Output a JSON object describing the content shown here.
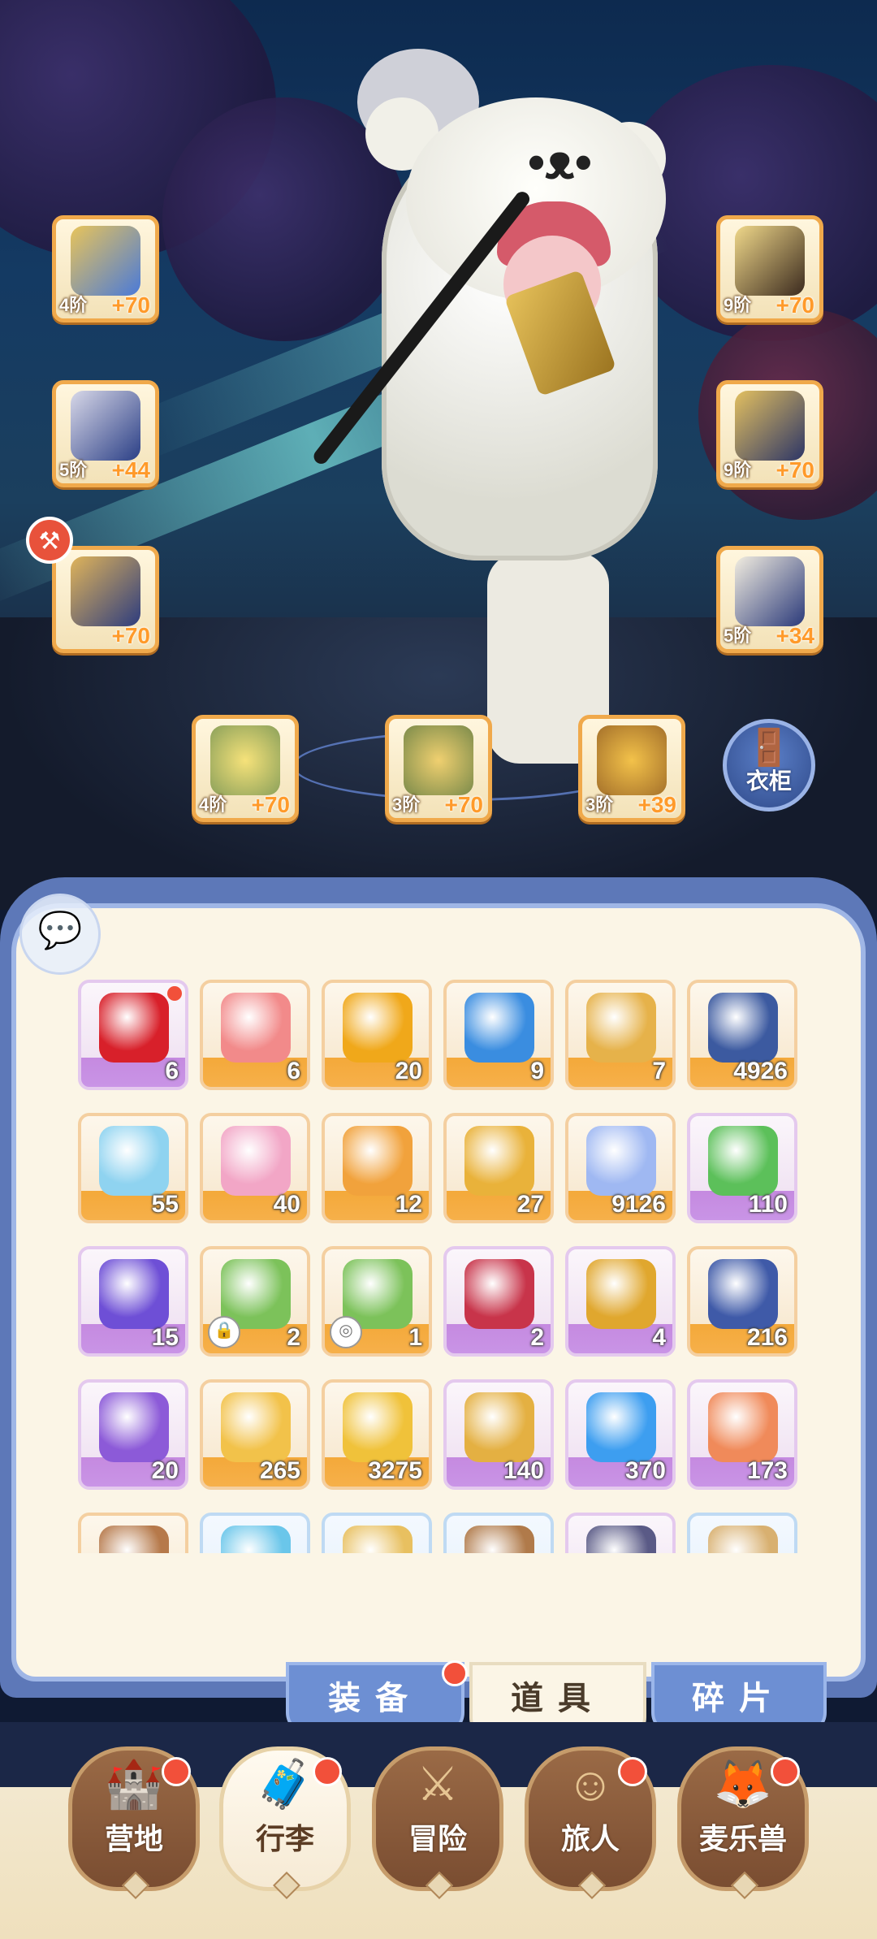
{
  "equipment": {
    "weapon": {
      "tier": "4阶",
      "level": "+70"
    },
    "helmet": {
      "tier": "9阶",
      "level": "+70"
    },
    "armor": {
      "tier": "5阶",
      "level": "+44"
    },
    "hat": {
      "tier": "9阶",
      "level": "+70"
    },
    "pants": {
      "tier": "",
      "level": "+70"
    },
    "boots": {
      "tier": "5阶",
      "level": "+34"
    },
    "ring": {
      "tier": "4阶",
      "level": "+70"
    },
    "necklace": {
      "tier": "3阶",
      "level": "+70"
    },
    "charm": {
      "tier": "3阶",
      "level": "+39"
    }
  },
  "wardrobe": {
    "label": "衣柜"
  },
  "inventory": [
    {
      "qty": "6",
      "rarity": "purple",
      "icon": "apple-icon",
      "color": "#d8202a",
      "new": true
    },
    {
      "qty": "6",
      "rarity": "orange",
      "icon": "ticket-icon",
      "color": "#f28a8a"
    },
    {
      "qty": "20",
      "rarity": "orange",
      "icon": "amber-gem-icon",
      "color": "#f0a81a"
    },
    {
      "qty": "9",
      "rarity": "orange",
      "icon": "potion-blue-icon",
      "color": "#3a8de0"
    },
    {
      "qty": "7",
      "rarity": "orange",
      "icon": "harp-icon",
      "color": "#e6b24a"
    },
    {
      "qty": "4926",
      "rarity": "orange",
      "icon": "orb-icon",
      "color": "#3c5aa0"
    },
    {
      "qty": "55",
      "rarity": "orange",
      "icon": "crystal-icon",
      "color": "#8fd3f0"
    },
    {
      "qty": "40",
      "rarity": "orange",
      "icon": "paint-tube-icon",
      "color": "#f2a6c6"
    },
    {
      "qty": "12",
      "rarity": "orange",
      "icon": "card-icon",
      "color": "#f1a23c"
    },
    {
      "qty": "27",
      "rarity": "orange",
      "icon": "bell-icon",
      "color": "#e9b23a"
    },
    {
      "qty": "9126",
      "rarity": "orange",
      "icon": "star-crystal-icon",
      "color": "#9fb8f2"
    },
    {
      "qty": "110",
      "rarity": "purple",
      "icon": "bear-token-icon",
      "color": "#5cc05a"
    },
    {
      "qty": "15",
      "rarity": "purple",
      "icon": "purple-gem-icon",
      "color": "#6e4fd6"
    },
    {
      "qty": "2",
      "rarity": "orange",
      "icon": "house-plant-icon",
      "color": "#7cc25a",
      "badge": "lock-icon"
    },
    {
      "qty": "1",
      "rarity": "orange",
      "icon": "house-plant-icon",
      "color": "#7cc25a",
      "badge": "coin-icon"
    },
    {
      "qty": "2",
      "rarity": "purple",
      "icon": "potion-red-icon",
      "color": "#c8344a"
    },
    {
      "qty": "4",
      "rarity": "purple",
      "icon": "key-icon",
      "color": "#e0a72e"
    },
    {
      "qty": "216",
      "rarity": "orange",
      "icon": "tarot-card-icon",
      "color": "#3f5aa8"
    },
    {
      "qty": "20",
      "rarity": "purple",
      "icon": "cat-mirror-icon",
      "color": "#8c5ad8"
    },
    {
      "qty": "265",
      "rarity": "orange",
      "icon": "cheese-icon",
      "color": "#f2c24a"
    },
    {
      "qty": "3275",
      "rarity": "orange",
      "icon": "golden-leaf-icon",
      "color": "#f0c23a"
    },
    {
      "qty": "140",
      "rarity": "purple",
      "icon": "star-cookie-icon",
      "color": "#e4b042"
    },
    {
      "qty": "370",
      "rarity": "purple",
      "icon": "blue-slime-icon",
      "color": "#3d9ef0"
    },
    {
      "qty": "173",
      "rarity": "purple",
      "icon": "scroll-ticket-icon",
      "color": "#f08a5a"
    },
    {
      "qty": "",
      "rarity": "orange",
      "icon": "book-icon",
      "color": "#b6794a"
    },
    {
      "qty": "",
      "rarity": "blue",
      "icon": "ice-shard-icon",
      "color": "#6ac6ea"
    },
    {
      "qty": "",
      "rarity": "blue",
      "icon": "cat-frame-icon",
      "color": "#e8c060"
    },
    {
      "qty": "",
      "rarity": "blue",
      "icon": "bag-icon",
      "color": "#b07a4a"
    },
    {
      "qty": "",
      "rarity": "purple",
      "icon": "block-icon",
      "color": "#5a5a86"
    },
    {
      "qty": "",
      "rarity": "blue",
      "icon": "box-icon",
      "color": "#d8b070"
    }
  ],
  "tabs": [
    {
      "label": "装备",
      "active": false,
      "dot": true
    },
    {
      "label": "道具",
      "active": true,
      "dot": false
    },
    {
      "label": "碎片",
      "active": false,
      "dot": false
    }
  ],
  "nav": [
    {
      "label": "营地",
      "icon": "castle-icon",
      "dot": true,
      "active": false
    },
    {
      "label": "行李",
      "icon": "luggage-icon",
      "dot": true,
      "active": true
    },
    {
      "label": "冒险",
      "icon": "crossed-swords-icon",
      "dot": false,
      "active": false
    },
    {
      "label": "旅人",
      "icon": "traveler-icon",
      "dot": true,
      "active": false
    },
    {
      "label": "麦乐兽",
      "icon": "beast-icon",
      "dot": true,
      "active": false
    }
  ]
}
